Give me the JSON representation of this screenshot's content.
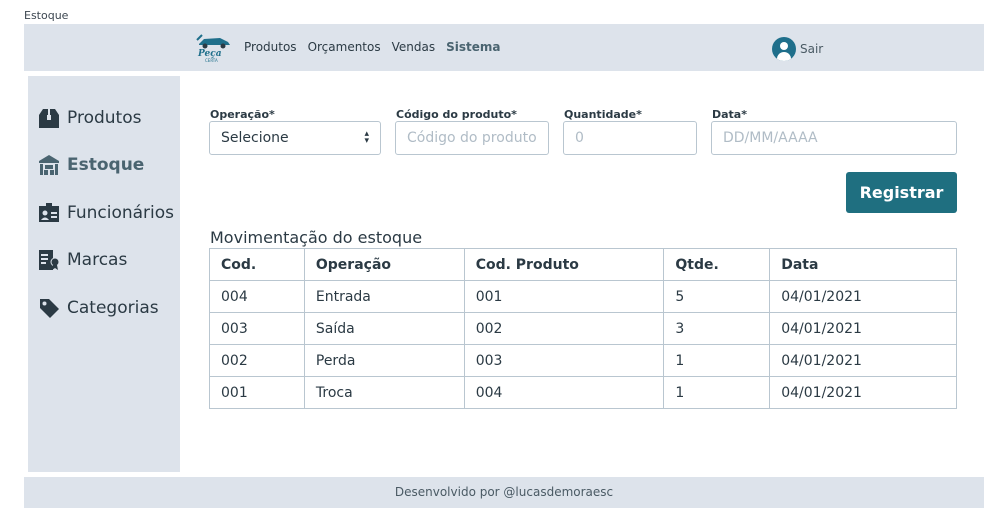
{
  "window": {
    "title": "Estoque"
  },
  "header": {
    "logo_text": "Peça",
    "logo_sub": "CERTA",
    "nav": [
      "Produtos",
      "Orçamentos",
      "Vendas",
      "Sistema"
    ],
    "active_nav": "Sistema",
    "user_label": "Sair"
  },
  "sidebar": {
    "items": [
      {
        "label": "Produtos",
        "icon": "box-icon"
      },
      {
        "label": "Estoque",
        "icon": "warehouse-icon",
        "active": true
      },
      {
        "label": "Funcionários",
        "icon": "id-card-icon"
      },
      {
        "label": "Marcas",
        "icon": "badge-icon"
      },
      {
        "label": "Categorias",
        "icon": "tag-icon"
      }
    ]
  },
  "form": {
    "operacao": {
      "label": "Operação*",
      "value": "Selecione"
    },
    "codigo": {
      "label": "Código do produto*",
      "placeholder": "Código do produto"
    },
    "quantidade": {
      "label": "Quantidade*",
      "placeholder": "0"
    },
    "data": {
      "label": "Data*",
      "placeholder": "DD/MM/AAAA"
    },
    "submit_label": "Registrar"
  },
  "table": {
    "title": "Movimentação do estoque",
    "headers": [
      "Cod.",
      "Operação",
      "Cod. Produto",
      "Qtde.",
      "Data"
    ],
    "rows": [
      [
        "004",
        "Entrada",
        "001",
        "5",
        "04/01/2021"
      ],
      [
        "003",
        "Saída",
        "002",
        "3",
        "04/01/2021"
      ],
      [
        "002",
        "Perda",
        "003",
        "1",
        "04/01/2021"
      ],
      [
        "001",
        "Troca",
        "004",
        "1",
        "04/01/2021"
      ]
    ]
  },
  "footer": {
    "text": "Desenvolvido por @lucasdemoraesc"
  },
  "colors": {
    "accent": "#1f6f80",
    "panel": "#dde3eb",
    "border": "#b9c6d0"
  }
}
